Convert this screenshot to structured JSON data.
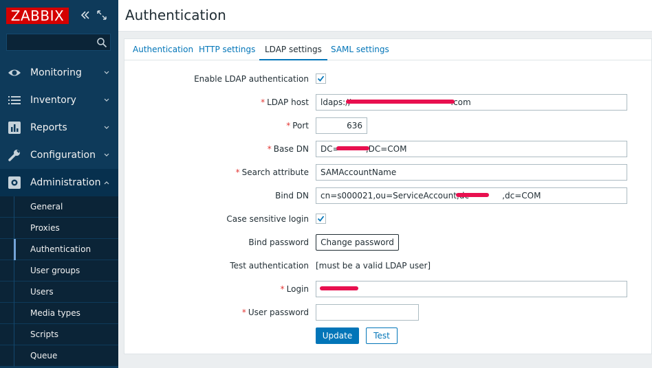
{
  "app": {
    "logo_text": "ZABBIX"
  },
  "sidebar": {
    "search_placeholder": "",
    "nav": [
      {
        "label": "Monitoring",
        "icon": "eye-icon"
      },
      {
        "label": "Inventory",
        "icon": "list-icon"
      },
      {
        "label": "Reports",
        "icon": "bar-chart-icon"
      },
      {
        "label": "Configuration",
        "icon": "wrench-icon"
      },
      {
        "label": "Administration",
        "icon": "gear-icon"
      }
    ],
    "admin_items": [
      "General",
      "Proxies",
      "Authentication",
      "User groups",
      "Users",
      "Media types",
      "Scripts",
      "Queue"
    ],
    "selected_item": "Authentication"
  },
  "page": {
    "title": "Authentication"
  },
  "tabs": [
    "Authentication",
    "HTTP settings",
    "LDAP settings",
    "SAML settings"
  ],
  "active_tab": "LDAP settings",
  "form": {
    "enable_ldap_label": "Enable LDAP authentication",
    "enable_ldap_checked": true,
    "ldap_host_label": "LDAP host",
    "ldap_host_value": "ldaps://                                      .com",
    "port_label": "Port",
    "port_value": "636",
    "base_dn_label": "Base DN",
    "base_dn_value": "DC=          ,DC=COM",
    "search_attr_label": "Search attribute",
    "search_attr_value": "SAMAccountName",
    "bind_dn_label": "Bind DN",
    "bind_dn_value": "cn=s000021,ou=ServiceAccount,dc=          ,dc=COM",
    "case_sensitive_label": "Case sensitive login",
    "case_sensitive_checked": true,
    "bind_password_label": "Bind password",
    "change_password_button": "Change password",
    "test_auth_label": "Test authentication",
    "test_auth_note": "[must be a valid LDAP user]",
    "login_label": "Login",
    "login_value": "",
    "user_password_label": "User password",
    "user_password_value": "",
    "update_button": "Update",
    "test_button": "Test",
    "required_marker": "*"
  },
  "colors": {
    "sidebar_bg": "#0e3a5a",
    "accent": "#0275b8",
    "logo_red": "#d40000",
    "required": "#e33734"
  }
}
